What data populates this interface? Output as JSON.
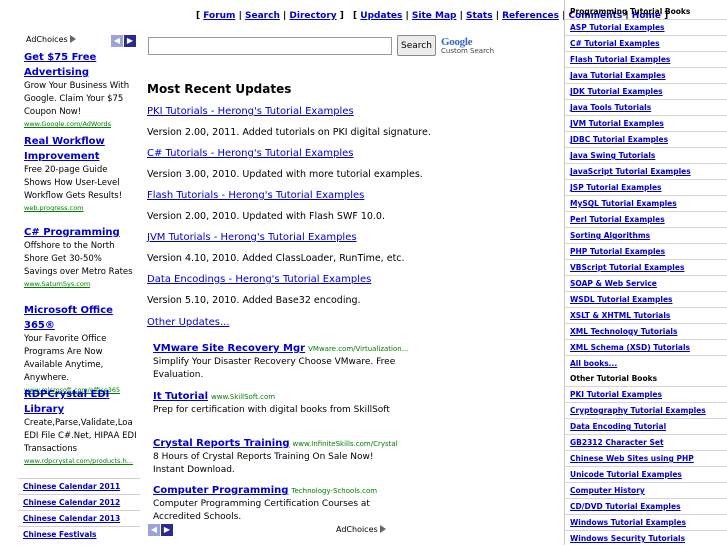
{
  "topnav": {
    "group1": [
      "Forum",
      "Search",
      "Directory"
    ],
    "group2": [
      "Updates",
      "Site Map",
      "Stats",
      "References",
      "Comments",
      "Home"
    ]
  },
  "left_ads": {
    "adchoices": "AdChoices",
    "ads": [
      {
        "title": "Get $75 Free Advertising",
        "body": "Grow Your Business With Google. Claim Your $75 Coupon Now!",
        "url": "www.Google.com/AdWords"
      },
      {
        "title": "Real Workflow Improvement",
        "body": "Free 20-page Guide Shows How User-Level Workflow Gets Results!",
        "url": "web.progress.com"
      },
      {
        "title": "C# Programming",
        "body": "Offshore to the North Shore Get 30-50% Savings over Metro Rates",
        "url": "www.SaturnSys.com"
      },
      {
        "title": "Microsoft Office 365®",
        "body": "Your Favorite Office Programs Are Now Available Anytime, Anywhere.",
        "url": "www.microsoft.com/office365"
      },
      {
        "title": "RDPCrystal EDI Library",
        "body": "Create,Parse,Validate,Loa EDI File C#.Net, HIPAA EDI Transactions",
        "url": "www.rdpcrystal.com/products.h..."
      }
    ],
    "links": [
      "Chinese Calendar 2011",
      "Chinese Calendar 2012",
      "Chinese Calendar 2013",
      "Chinese Festivals"
    ]
  },
  "search": {
    "value": "",
    "button_label": "Search",
    "google": "Google",
    "custom_label": "Custom Search"
  },
  "main": {
    "heading": "Most Recent Updates",
    "updates": [
      {
        "link": "PKI Tutorials - Herong's Tutorial Examples",
        "desc": "Version 2.00, 2011. Added tutorials on PKI digital signature."
      },
      {
        "link": "C# Tutorials - Herong's Tutorial Examples",
        "desc": "Version 3.00, 2010. Updated with more tutorial examples."
      },
      {
        "link": "Flash Tutorials - Herong's Tutorial Examples",
        "desc": "Version 2.00, 2010. Updated with Flash SWF 10.0."
      },
      {
        "link": "JVM Tutorials - Herong's Tutorial Examples",
        "desc": "Version 4.10, 2010. Added ClassLoader, RunTime, etc."
      },
      {
        "link": "Data Encodings - Herong's Tutorial Examples",
        "desc": "Version 5.10, 2010. Added Base32 encoding."
      }
    ],
    "other_updates": "Other Updates...",
    "ads": [
      {
        "title": "VMware Site Recovery Mgr",
        "url": "VMware.com/Virtualization...",
        "body": "Simplify Your Disaster Recovery Choose VMware. Free Evaluation."
      },
      {
        "title": "It Tutorial",
        "url": "www.SkillSoft.com",
        "body": "Prep for certification with digital books from SkillSoft"
      },
      {
        "title": "Crystal Reports Training",
        "url": "www.InfiniteSkills.com/Crystal",
        "body": "8 Hours of Crystal Reports Training On Sale Now! Instant Download."
      },
      {
        "title": "Computer Programming",
        "url": "Technology-Schools.com",
        "body": "Computer Programming Certification Courses at Accredited Schools."
      }
    ],
    "adchoices": "AdChoices"
  },
  "right": {
    "programming_heading": "Programming Tutorial Books",
    "programming": [
      "ASP Tutorial Examples",
      "C# Tutorial Examples",
      "Flash Tutorial Examples",
      "Java Tutorial Examples",
      "JDK Tutorial Examples",
      "Java Tools Tutorials",
      "JVM Tutorial Examples",
      "JDBC Tutorial Examples",
      "Java Swing Tutorials",
      "JavaScript Tutorial Examples",
      "JSP Tutorial Examples",
      "MySQL Tutorial Examples",
      "Perl Tutorial Examples",
      "Sorting Algorithms",
      "PHP Tutorial Examples",
      "VBScript Tutorial Examples",
      "SOAP & Web Service",
      "WSDL Tutorial Examples",
      "XSLT & XHTML Tutorials",
      "XML Technology Tutorials",
      "XML Schema (XSD) Tutorials",
      "All books..."
    ],
    "other_heading": "Other Tutorial Books",
    "other": [
      "PKI Tutorial Examples",
      "Cryptography Tutorial Examples",
      "Data Encoding Tutorial",
      "GB2312 Character Set",
      "Chinese Web Sites using PHP",
      "Unicode Tutorial Examples",
      "Computer History",
      "CD/DVD Tutorial Examples",
      "Windows Tutorial Examples",
      "Windows Security Tutorials"
    ]
  },
  "colors": {
    "link": "#0000cc",
    "ad_url": "#008000",
    "arrow_active": "#2b2b8f",
    "arrow_inactive": "#9aa4d6"
  }
}
